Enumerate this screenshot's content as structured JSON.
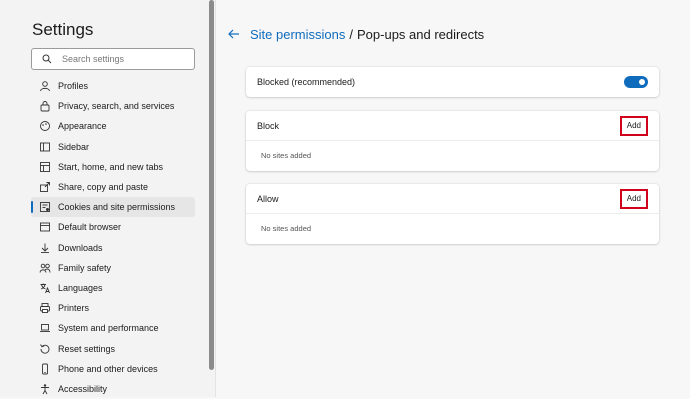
{
  "sidebar": {
    "title": "Settings",
    "search_placeholder": "Search settings",
    "items": [
      {
        "label": "Profiles",
        "icon": "profile-icon"
      },
      {
        "label": "Privacy, search, and services",
        "icon": "lock-icon"
      },
      {
        "label": "Appearance",
        "icon": "appearance-icon"
      },
      {
        "label": "Sidebar",
        "icon": "sidebar-icon"
      },
      {
        "label": "Start, home, and new tabs",
        "icon": "home-icon"
      },
      {
        "label": "Share, copy and paste",
        "icon": "share-icon"
      },
      {
        "label": "Cookies and site permissions",
        "icon": "cookies-icon",
        "active": true
      },
      {
        "label": "Default browser",
        "icon": "browser-icon"
      },
      {
        "label": "Downloads",
        "icon": "download-icon"
      },
      {
        "label": "Family safety",
        "icon": "family-icon"
      },
      {
        "label": "Languages",
        "icon": "languages-icon"
      },
      {
        "label": "Printers",
        "icon": "printer-icon"
      },
      {
        "label": "System and performance",
        "icon": "laptop-icon"
      },
      {
        "label": "Reset settings",
        "icon": "reset-icon"
      },
      {
        "label": "Phone and other devices",
        "icon": "phone-icon"
      },
      {
        "label": "Accessibility",
        "icon": "accessibility-icon"
      }
    ]
  },
  "header": {
    "breadcrumb_link": "Site permissions",
    "separator": "/",
    "current": "Pop-ups and redirects"
  },
  "blocked_card": {
    "label": "Blocked (recommended)",
    "toggle_on": true
  },
  "block_card": {
    "title": "Block",
    "add_label": "Add",
    "empty_text": "No sites added"
  },
  "allow_card": {
    "title": "Allow",
    "add_label": "Add",
    "empty_text": "No sites added"
  },
  "colors": {
    "accent": "#0f6cbd",
    "highlight_border": "#d0021b"
  }
}
